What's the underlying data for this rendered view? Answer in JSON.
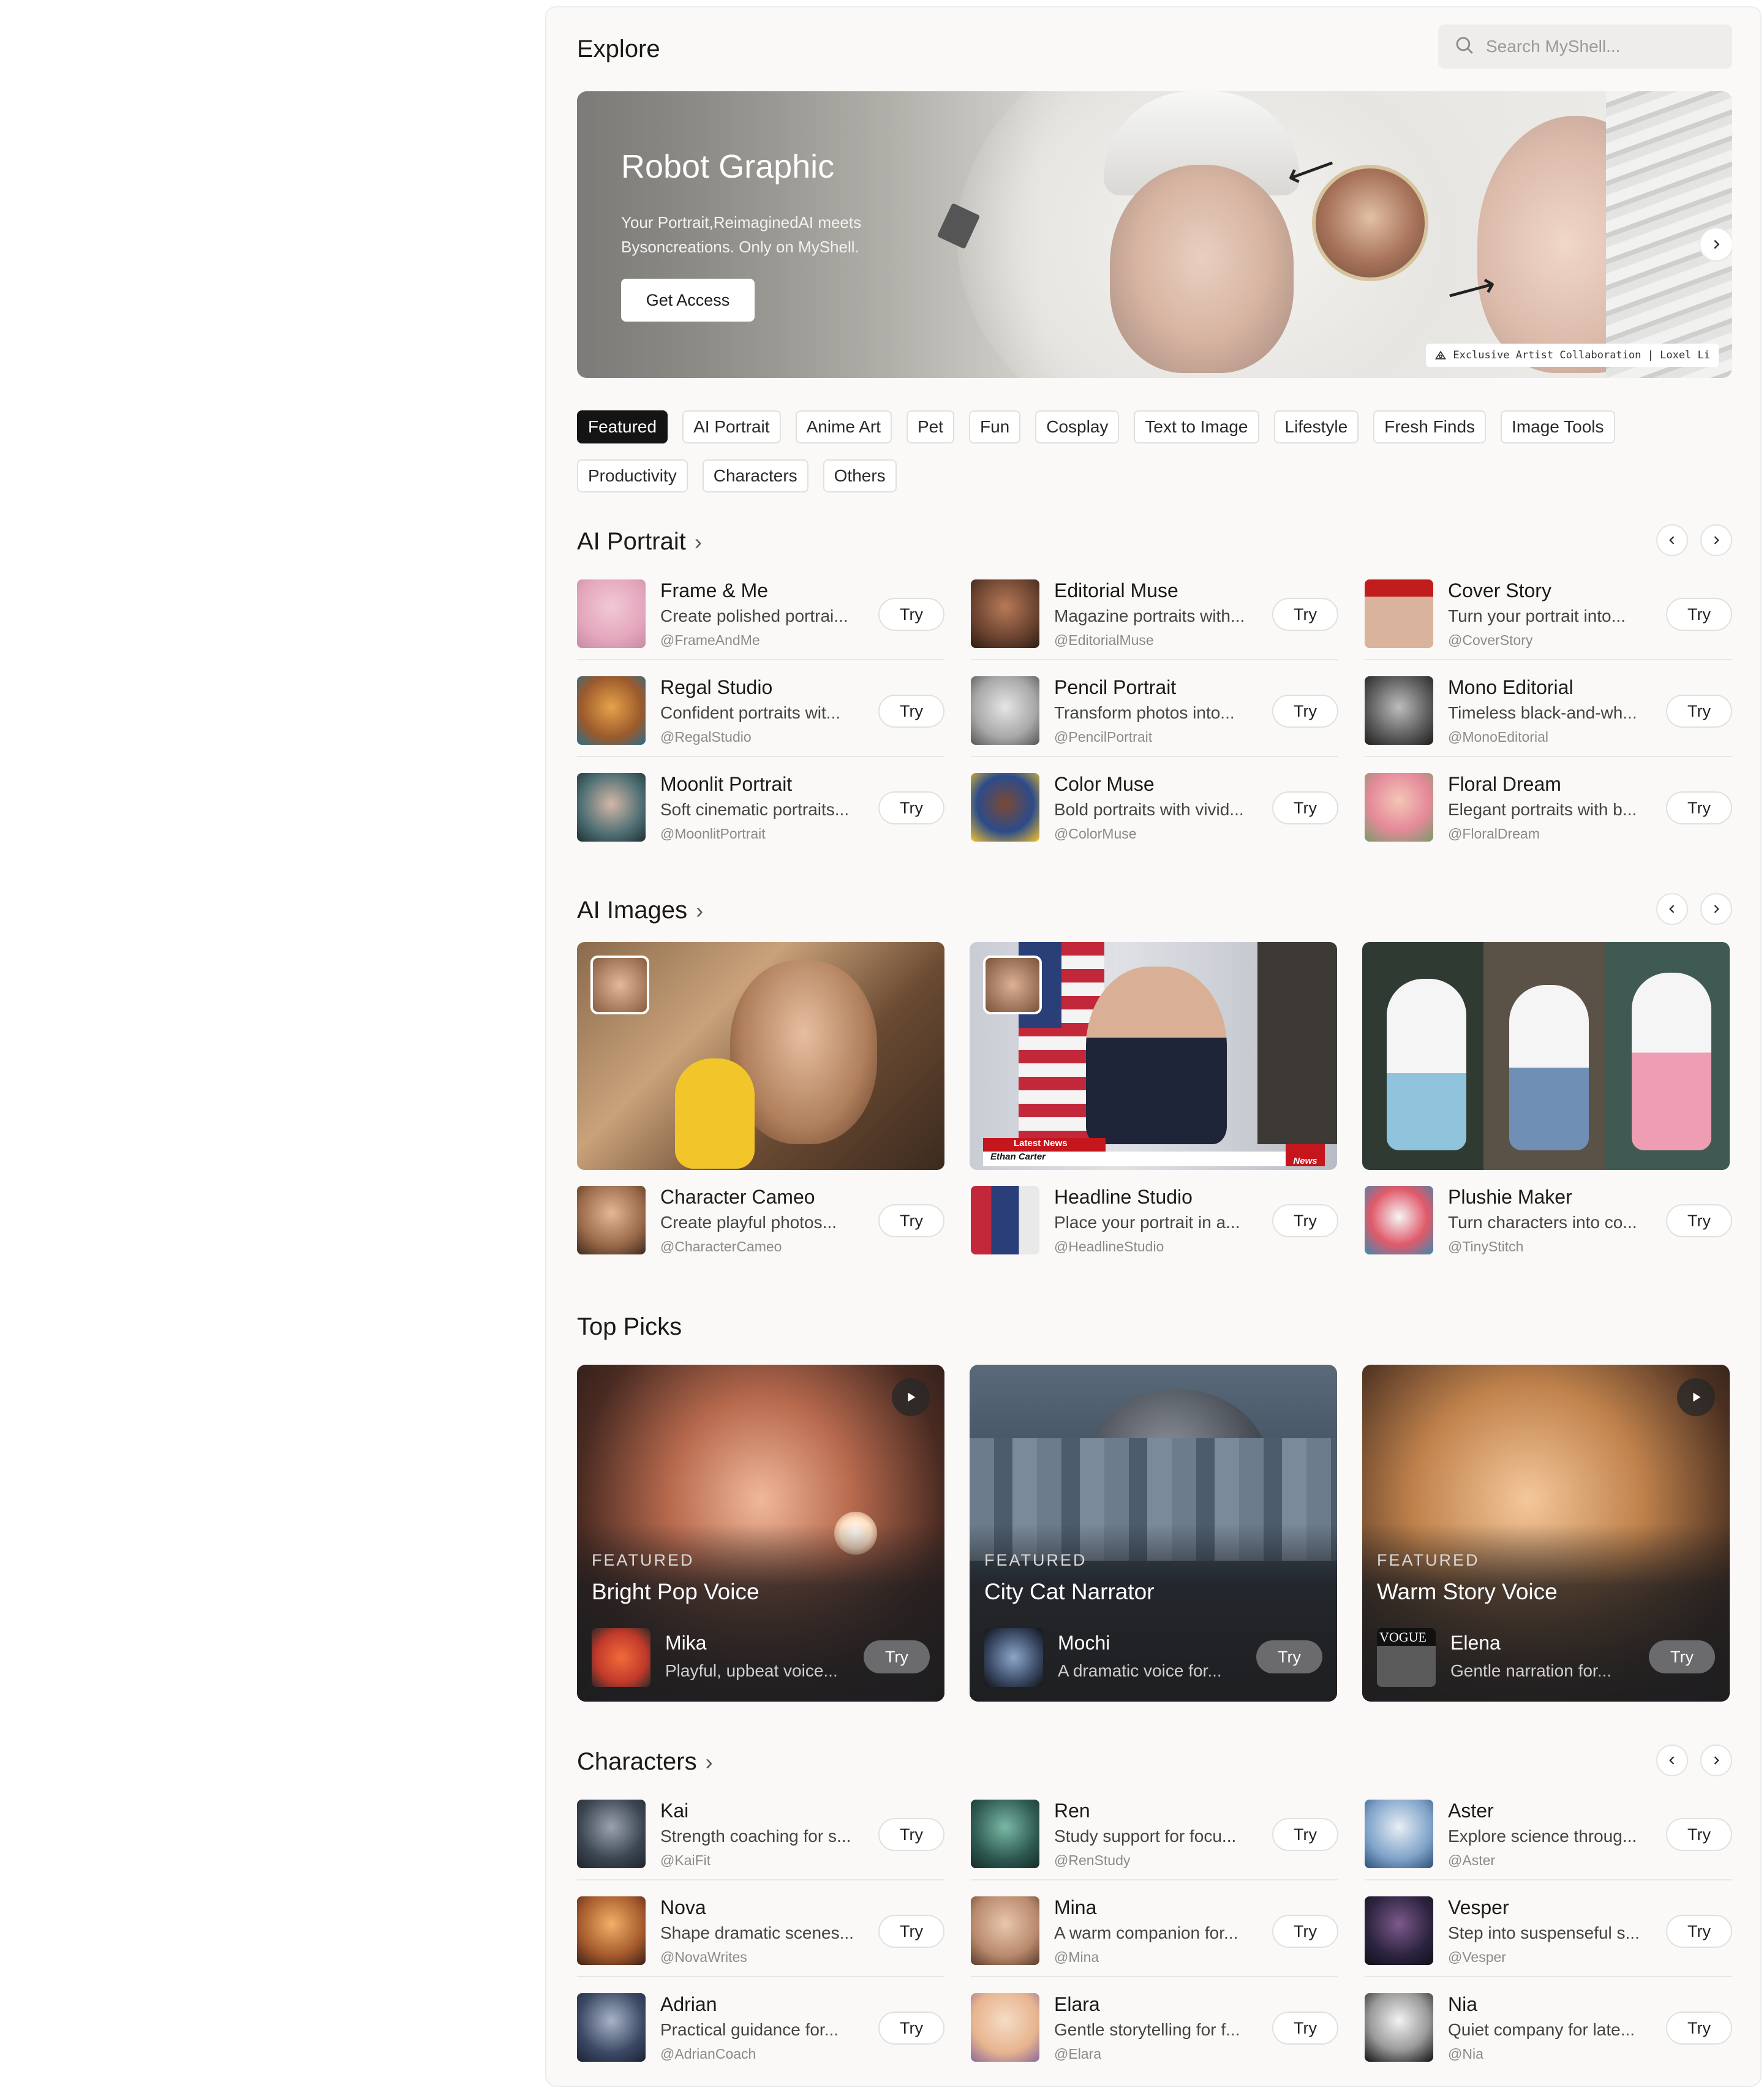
{
  "header": {
    "title": "Explore",
    "search_placeholder": "Search MyShell..."
  },
  "banner": {
    "title": "Robot Graphic",
    "subtitle": "Your Portrait,ReimaginedAI meets Bysoncreations. Only on MyShell.",
    "cta": "Get Access",
    "tag": "Exclusive Artist Collaboration | Loxel Li"
  },
  "chips_row1": [
    "Featured",
    "AI Portrait",
    "Anime Art",
    "Pet",
    "Fun",
    "Cosplay",
    "Text to Image",
    "Lifestyle",
    "Fresh Finds",
    "Image Tools"
  ],
  "chips_row2": [
    "Productivity",
    "Characters",
    "Others"
  ],
  "try_label": "Try",
  "ai_portrait": {
    "title": "AI Portrait",
    "items": [
      {
        "name": "Frame & Me",
        "desc": "Create polished portrai...",
        "handle": "@FrameAndMe"
      },
      {
        "name": "Editorial Muse",
        "desc": "Magazine portraits with...",
        "handle": "@EditorialMuse"
      },
      {
        "name": "Cover Story",
        "desc": "Turn your portrait into...",
        "handle": "@CoverStory"
      },
      {
        "name": "Regal Studio",
        "desc": "Confident portraits wit...",
        "handle": "@RegalStudio"
      },
      {
        "name": "Pencil Portrait",
        "desc": "Transform photos into...",
        "handle": "@PencilPortrait"
      },
      {
        "name": "Mono Editorial",
        "desc": "Timeless black-and-wh...",
        "handle": "@MonoEditorial"
      },
      {
        "name": "Moonlit Portrait",
        "desc": "Soft cinematic portraits...",
        "handle": "@MoonlitPortrait"
      },
      {
        "name": "Color Muse",
        "desc": "Bold portraits with vivid...",
        "handle": "@ColorMuse"
      },
      {
        "name": "Floral Dream",
        "desc": "Elegant portraits with b...",
        "handle": "@FloralDream"
      }
    ]
  },
  "ai_images": {
    "title": "AI Images",
    "news_label": "Latest News",
    "news_name": "Ethan Carter",
    "news_badge": "News",
    "items": [
      {
        "name": "Character Cameo",
        "desc": "Create playful photos...",
        "handle": "@CharacterCameo"
      },
      {
        "name": "Headline Studio",
        "desc": "Place your portrait in a...",
        "handle": "@HeadlineStudio"
      },
      {
        "name": "Plushie Maker",
        "desc": "Turn characters into co...",
        "handle": "@TinyStitch"
      }
    ]
  },
  "top_picks": {
    "title": "Top Picks",
    "items": [
      {
        "label": "FEATURED",
        "title": "Bright Pop Voice",
        "name": "Mika",
        "desc": "Playful, upbeat voice..."
      },
      {
        "label": "FEATURED",
        "title": "City Cat Narrator",
        "name": "Mochi",
        "desc": "A dramatic voice for..."
      },
      {
        "label": "FEATURED",
        "title": "Warm Story Voice",
        "name": "Elena",
        "desc": "Gentle narration for...",
        "avatar_text": "VOGUE"
      }
    ]
  },
  "characters": {
    "title": "Characters",
    "items": [
      {
        "name": "Kai",
        "desc": "Strength coaching for s...",
        "handle": "@KaiFit"
      },
      {
        "name": "Ren",
        "desc": "Study support for focu...",
        "handle": "@RenStudy"
      },
      {
        "name": "Aster",
        "desc": "Explore science throug...",
        "handle": "@Aster"
      },
      {
        "name": "Nova",
        "desc": "Shape dramatic scenes...",
        "handle": "@NovaWrites"
      },
      {
        "name": "Mina",
        "desc": "A warm companion for...",
        "handle": "@Mina"
      },
      {
        "name": "Vesper",
        "desc": "Step into suspenseful s...",
        "handle": "@Vesper"
      },
      {
        "name": "Adrian",
        "desc": "Practical guidance for...",
        "handle": "@AdrianCoach"
      },
      {
        "name": "Elara",
        "desc": "Gentle storytelling for f...",
        "handle": "@Elara"
      },
      {
        "name": "Nia",
        "desc": "Quiet company for late...",
        "handle": "@Nia"
      }
    ]
  }
}
